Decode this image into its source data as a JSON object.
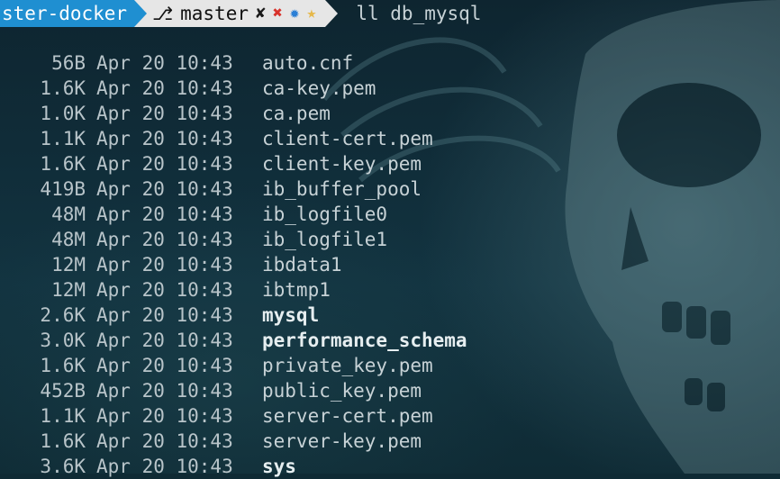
{
  "prompt": {
    "host": "ster-docker",
    "branch_icon": "git-branch-icon",
    "branch": "master",
    "status_marks": [
      "✘",
      "✖",
      "✹",
      "★"
    ],
    "command": "ll db_mysql"
  },
  "colors": {
    "host_bg": "#1f8fd1",
    "git_bg": "#e6e6e6",
    "status_red": "#d8322b",
    "status_blue": "#2a7fd6",
    "status_gold": "#e6b84a",
    "terminal_bg": "#0f2a34"
  },
  "listing": [
    {
      "size": "56B",
      "date": "Apr 20 10:43",
      "name": "auto.cnf",
      "dir": false
    },
    {
      "size": "1.6K",
      "date": "Apr 20 10:43",
      "name": "ca-key.pem",
      "dir": false
    },
    {
      "size": "1.0K",
      "date": "Apr 20 10:43",
      "name": "ca.pem",
      "dir": false
    },
    {
      "size": "1.1K",
      "date": "Apr 20 10:43",
      "name": "client-cert.pem",
      "dir": false
    },
    {
      "size": "1.6K",
      "date": "Apr 20 10:43",
      "name": "client-key.pem",
      "dir": false
    },
    {
      "size": "419B",
      "date": "Apr 20 10:43",
      "name": "ib_buffer_pool",
      "dir": false
    },
    {
      "size": "48M",
      "date": "Apr 20 10:43",
      "name": "ib_logfile0",
      "dir": false
    },
    {
      "size": "48M",
      "date": "Apr 20 10:43",
      "name": "ib_logfile1",
      "dir": false
    },
    {
      "size": "12M",
      "date": "Apr 20 10:43",
      "name": "ibdata1",
      "dir": false
    },
    {
      "size": "12M",
      "date": "Apr 20 10:43",
      "name": "ibtmp1",
      "dir": false
    },
    {
      "size": "2.6K",
      "date": "Apr 20 10:43",
      "name": "mysql",
      "dir": true
    },
    {
      "size": "3.0K",
      "date": "Apr 20 10:43",
      "name": "performance_schema",
      "dir": true
    },
    {
      "size": "1.6K",
      "date": "Apr 20 10:43",
      "name": "private_key.pem",
      "dir": false
    },
    {
      "size": "452B",
      "date": "Apr 20 10:43",
      "name": "public_key.pem",
      "dir": false
    },
    {
      "size": "1.1K",
      "date": "Apr 20 10:43",
      "name": "server-cert.pem",
      "dir": false
    },
    {
      "size": "1.6K",
      "date": "Apr 20 10:43",
      "name": "server-key.pem",
      "dir": false
    },
    {
      "size": "3.6K",
      "date": "Apr 20 10:43",
      "name": "sys",
      "dir": true
    }
  ]
}
